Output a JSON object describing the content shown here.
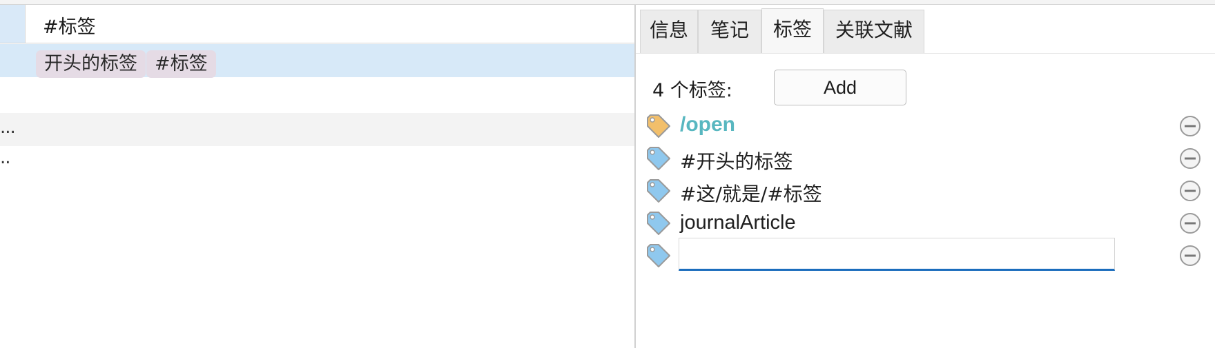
{
  "left": {
    "header_text": "#标签",
    "selected_row_chips": [
      "开头的标签",
      "#标签"
    ],
    "row_alt_text": "...",
    "row_plain_text": ".."
  },
  "tabs": [
    {
      "label": "信息",
      "active": false
    },
    {
      "label": "笔记",
      "active": false
    },
    {
      "label": "标签",
      "active": true
    },
    {
      "label": "关联文献",
      "active": false
    }
  ],
  "tags_panel": {
    "count_label": "4 个标签:",
    "add_label": "Add",
    "tags": [
      {
        "text": "/open",
        "colored": true,
        "icon": "tag-icon-orange"
      },
      {
        "text": "#开头的标签",
        "colored": false,
        "icon": "tag-icon-blue"
      },
      {
        "text": "#这/就是/#标签",
        "colored": false,
        "icon": "tag-icon-blue"
      },
      {
        "text": "journalArticle",
        "colored": false,
        "icon": "tag-icon-blue"
      }
    ],
    "new_tag_value": "",
    "colors": {
      "accent": "#1b6dbd",
      "colored_tag": "#58b7c0",
      "tag_blue": "#8fc8ee",
      "tag_orange": "#f2bf6b",
      "selected_row": "#d7e9f8",
      "chip": "#e5dbe5"
    }
  }
}
